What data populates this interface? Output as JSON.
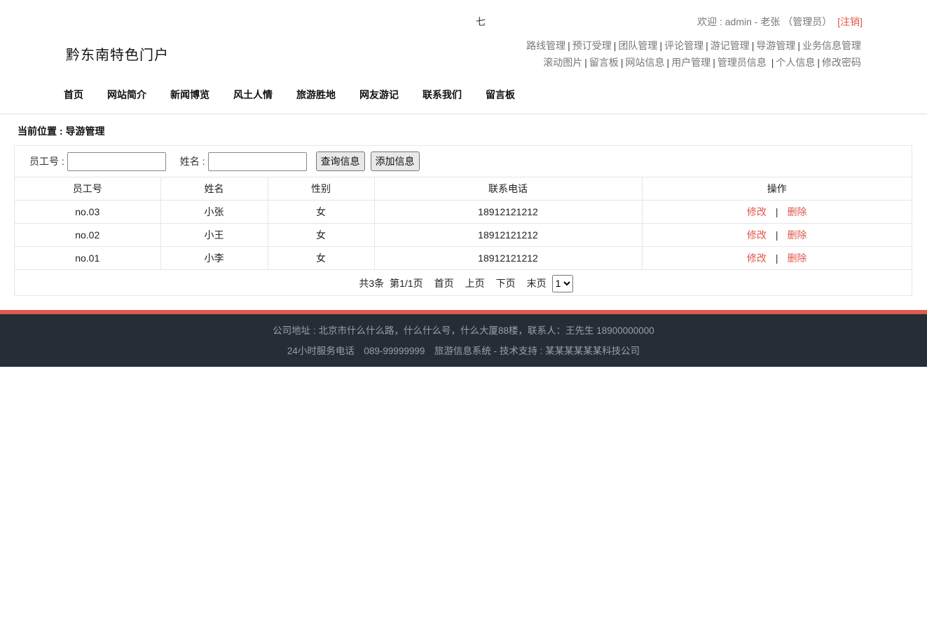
{
  "header": {
    "top_char": "七",
    "welcome": "欢迎 : admin - 老张 （管理员）",
    "logout": "[注销]",
    "site_title": "黔东南特色门户",
    "admin_links_row1": [
      "路线管理",
      "预订受理",
      "团队管理",
      "评论管理",
      "游记管理",
      "导游管理",
      "业务信息管理"
    ],
    "admin_links_row2": [
      "滚动图片",
      "留言板",
      "网站信息",
      "用户管理",
      "管理员信息",
      "个人信息",
      "修改密码"
    ],
    "nav": [
      "首页",
      "网站简介",
      "新闻博览",
      "风土人情",
      "旅游胜地",
      "网友游记",
      "联系我们",
      "留言板"
    ]
  },
  "breadcrumb": "当前位置 : 导游管理",
  "search": {
    "staff_no_label": "员工号 :",
    "staff_no_value": "",
    "name_label": "姓名 :",
    "name_value": "",
    "query_button": "查询信息",
    "add_button": "添加信息"
  },
  "table": {
    "columns": [
      "员工号",
      "姓名",
      "性别",
      "联系电话",
      "操作"
    ],
    "rows": [
      {
        "staff_no": "no.03",
        "name": "小张",
        "gender": "女",
        "phone": "18912121212",
        "edit": "修改",
        "sep": "|",
        "delete": "删除"
      },
      {
        "staff_no": "no.02",
        "name": "小王",
        "gender": "女",
        "phone": "18912121212",
        "edit": "修改",
        "sep": "|",
        "delete": "删除"
      },
      {
        "staff_no": "no.01",
        "name": "小李",
        "gender": "女",
        "phone": "18912121212",
        "edit": "修改",
        "sep": "|",
        "delete": "删除"
      }
    ]
  },
  "pager": {
    "total": "共3条",
    "page": "第1/1页",
    "first": "首页",
    "prev": "上页",
    "next": "下页",
    "last": "末页",
    "selected_page": "1"
  },
  "footer": {
    "line1": "公司地址 : 北京市什么什么路，什么什么号，什么大厦88楼，联系人：王先生 18900000000",
    "line2": "24小时服务电话　089-99999999　旅游信息系统 - 技术支持 : 某某某某某某科技公司"
  },
  "colors": {
    "accent": "#e2594d",
    "footer_bg": "#262d36"
  }
}
